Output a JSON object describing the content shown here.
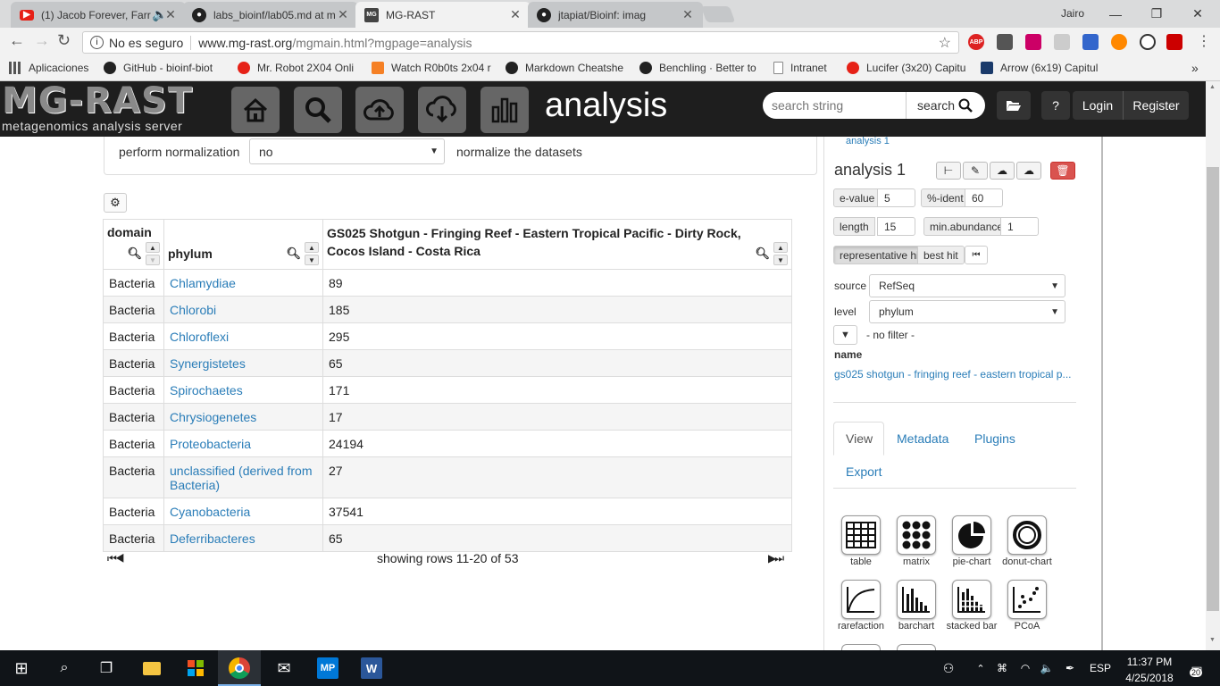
{
  "browser": {
    "tabs": [
      {
        "title": "(1) Jacob Forever, Farr",
        "icon_color": "#e62117",
        "icon": "youtube-icon"
      },
      {
        "title": "labs_bioinf/lab05.md at m",
        "icon_color": "#222222",
        "icon": "github-icon"
      },
      {
        "title": "MG-RAST",
        "icon_color": "#444444",
        "icon": "mgrast-icon"
      },
      {
        "title": "jtapiat/Bioinf: imag",
        "icon_color": "#222222",
        "icon": "github-icon"
      }
    ],
    "user": "Jairo",
    "security_label": "No es seguro",
    "url_host": "www.mg-rast.org",
    "url_path": "/mgmain.html?mgpage=analysis",
    "extensions": [
      "ABP",
      "",
      "",
      "",
      "",
      "",
      "",
      ""
    ],
    "bookmarks": [
      {
        "label": "Aplicaciones",
        "color": "#555555"
      },
      {
        "label": "GitHub - bioinf-biot",
        "color": "#222222"
      },
      {
        "label": "Mr. Robot 2X04 Onli",
        "color": "#e62117"
      },
      {
        "label": "Watch R0b0ts 2x04 r",
        "color": "#f58025"
      },
      {
        "label": "Markdown Cheatshe",
        "color": "#222222"
      },
      {
        "label": "Benchling · Better to",
        "color": "#222222"
      },
      {
        "label": "Intranet",
        "color": "#888888"
      },
      {
        "label": "Lucifer (3x20) Capitu",
        "color": "#e62117"
      },
      {
        "label": "Arrow (6x19) Capitul",
        "color": "#1a3a6a"
      }
    ]
  },
  "app": {
    "logo_main": "MG-RAST",
    "logo_sub": "metagenomics analysis server",
    "page_title": "analysis",
    "search_placeholder": "search string",
    "search_button": "search",
    "help": "?",
    "login": "Login",
    "register": "Register"
  },
  "normalization": {
    "label": "perform normalization",
    "value": "no",
    "note": "normalize the datasets"
  },
  "table": {
    "headers": {
      "domain": "domain",
      "phylum": "phylum",
      "dataset": "GS025 Shotgun - Fringing Reef - Eastern Tropical Pacific - Dirty Rock, Cocos Island - Costa Rica"
    },
    "rows": [
      {
        "domain": "Bacteria",
        "phylum": "Chlamydiae",
        "value": "89"
      },
      {
        "domain": "Bacteria",
        "phylum": "Chlorobi",
        "value": "185"
      },
      {
        "domain": "Bacteria",
        "phylum": "Chloroflexi",
        "value": "295"
      },
      {
        "domain": "Bacteria",
        "phylum": "Synergistetes",
        "value": "65"
      },
      {
        "domain": "Bacteria",
        "phylum": "Spirochaetes",
        "value": "171"
      },
      {
        "domain": "Bacteria",
        "phylum": "Chrysiogenetes",
        "value": "17"
      },
      {
        "domain": "Bacteria",
        "phylum": "Proteobacteria",
        "value": "24194"
      },
      {
        "domain": "Bacteria",
        "phylum": "unclassified (derived from Bacteria)",
        "value": "27"
      },
      {
        "domain": "Bacteria",
        "phylum": "Cyanobacteria",
        "value": "37541"
      },
      {
        "domain": "Bacteria",
        "phylum": "Deferribacteres",
        "value": "65"
      }
    ],
    "pager_text": "showing rows 11-20 of 53"
  },
  "panel": {
    "crumb": "analysis 1",
    "title": "analysis 1",
    "evalue_label": "e-value",
    "evalue": "5",
    "ident_label": "%-ident",
    "ident": "60",
    "length_label": "length",
    "length": "15",
    "minab_label": "min.abundance",
    "minab": "1",
    "rep_hit": "representative hit",
    "best_hit": "best hit",
    "source_label": "source",
    "source_value": "RefSeq",
    "level_label": "level",
    "level_value": "phylum",
    "filter_text": "- no filter -",
    "name_label": "name",
    "dataset_name": "gs025 shotgun - fringing reef - eastern tropical p...",
    "tabs": [
      "View",
      "Metadata",
      "Plugins",
      "Export"
    ],
    "visuals": [
      "table",
      "matrix",
      "pie-chart",
      "donut-chart",
      "rarefaction",
      "barchart",
      "stacked bar",
      "PCoA"
    ]
  },
  "taskbar": {
    "lang": "ESP",
    "time": "11:37 PM",
    "date": "4/25/2018",
    "notifications": "20"
  }
}
